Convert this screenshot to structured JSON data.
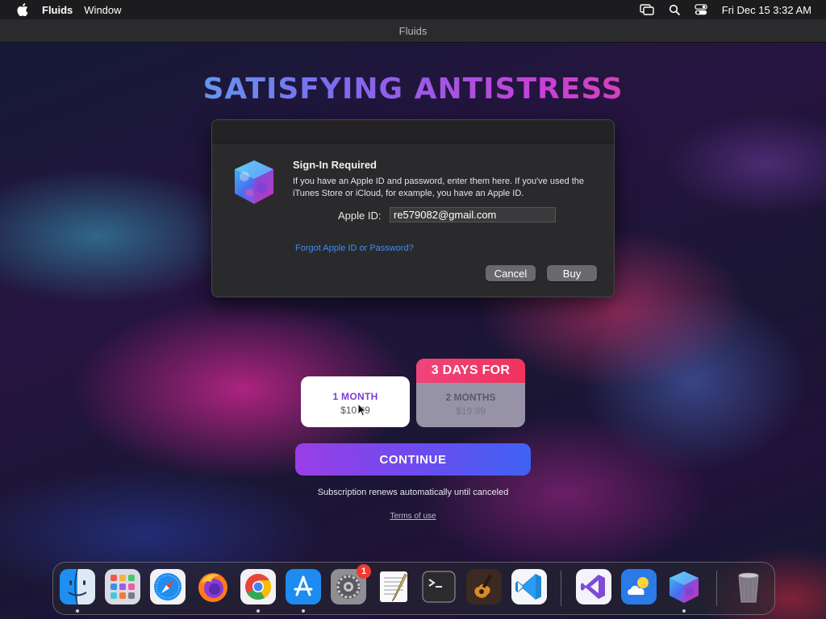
{
  "menubar": {
    "app_name": "Fluids",
    "menus": [
      "Window"
    ],
    "clock": "Fri Dec 15  3:32 AM",
    "status_icons": [
      "screen-mirroring-icon",
      "spotlight-search-icon",
      "control-center-icon"
    ]
  },
  "window": {
    "title": "Fluids"
  },
  "headline": "SATISFYING ANTISTRESS",
  "headline_colors": [
    "#3fd6f2",
    "#7c6cf0",
    "#c641d8",
    "#f0447a"
  ],
  "dialog": {
    "title": "Sign-In Required",
    "message": "If you have an Apple ID and password, enter them here. If you've used the iTunes Store or iCloud, for example, you have an Apple ID.",
    "apple_id_label": "Apple ID:",
    "apple_id_value": "re579082@gmail.com",
    "forgot_link": "Forgot Apple ID or Password?",
    "cancel_label": "Cancel",
    "buy_label": "Buy"
  },
  "plans": [
    {
      "name": "1 MONTH",
      "price": "$10.99",
      "selected": true
    },
    {
      "banner": "3 DAYS FOR",
      "name": "2 MONTHS",
      "price": "$19.99",
      "selected": false
    }
  ],
  "continue_label": "CONTINUE",
  "renew_text": "Subscription renews automatically until canceled",
  "terms_link": "Terms of use",
  "accent_colors": {
    "link": "#3c8ef2",
    "plan_selected_text": "#7a3fd3",
    "banner": "#f0447a",
    "continue_start": "#9a3ee6",
    "continue_end": "#3e62f2"
  },
  "dock": {
    "apps": [
      {
        "name": "Finder",
        "icon": "finder-icon",
        "running": true
      },
      {
        "name": "Launchpad",
        "icon": "launchpad-icon",
        "running": false
      },
      {
        "name": "Safari",
        "icon": "safari-icon",
        "running": false
      },
      {
        "name": "Firefox",
        "icon": "firefox-icon",
        "running": false
      },
      {
        "name": "Chrome",
        "icon": "chrome-icon",
        "running": true
      },
      {
        "name": "App Store",
        "icon": "app-store-icon",
        "running": true
      },
      {
        "name": "System Settings",
        "icon": "system-settings-icon",
        "running": false,
        "badge": "1"
      },
      {
        "name": "TextEdit",
        "icon": "textedit-icon",
        "running": false
      },
      {
        "name": "Terminal",
        "icon": "terminal-icon",
        "running": false
      },
      {
        "name": "GarageBand",
        "icon": "garageband-icon",
        "running": false
      },
      {
        "name": "VS Code",
        "icon": "vscode-icon",
        "running": false
      },
      {
        "name": "Visual Studio",
        "icon": "visual-studio-icon",
        "running": false
      },
      {
        "name": "Weather",
        "icon": "weather-icon",
        "running": false
      },
      {
        "name": "Fluids",
        "icon": "fluids-icon",
        "running": true
      },
      {
        "name": "Trash",
        "icon": "trash-icon",
        "running": false
      }
    ]
  }
}
